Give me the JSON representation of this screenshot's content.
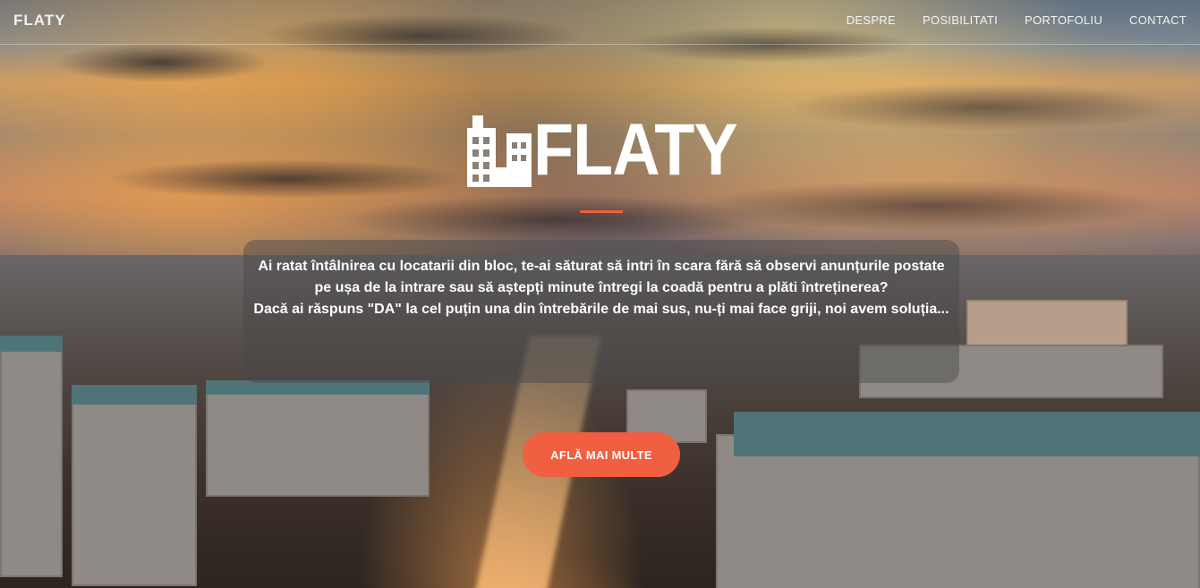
{
  "navbar": {
    "brand": "FLATY",
    "links": [
      "DESPRE",
      "POSIBILITATI",
      "PORTOFOLIU",
      "CONTACT"
    ]
  },
  "hero": {
    "logo_text": "FLATY",
    "logo_icon": "building-icon",
    "paragraph_1": "Ai ratat întâlnirea cu locatarii din bloc, te-ai săturat să intri în scara fără să observi anunțurile postate pe ușa de la intrare sau să aștepți minute întregi la coadă pentru a plăti întreținerea?",
    "paragraph_2": "Dacă ai răspuns \"DA\" la cel puțin una din întrebările de mai sus, nu-ți mai face griji, noi avem soluția...",
    "cta_label": "AFLĂ MAI MULTE"
  },
  "colors": {
    "accent": "#f05f40",
    "text": "#ffffff"
  }
}
